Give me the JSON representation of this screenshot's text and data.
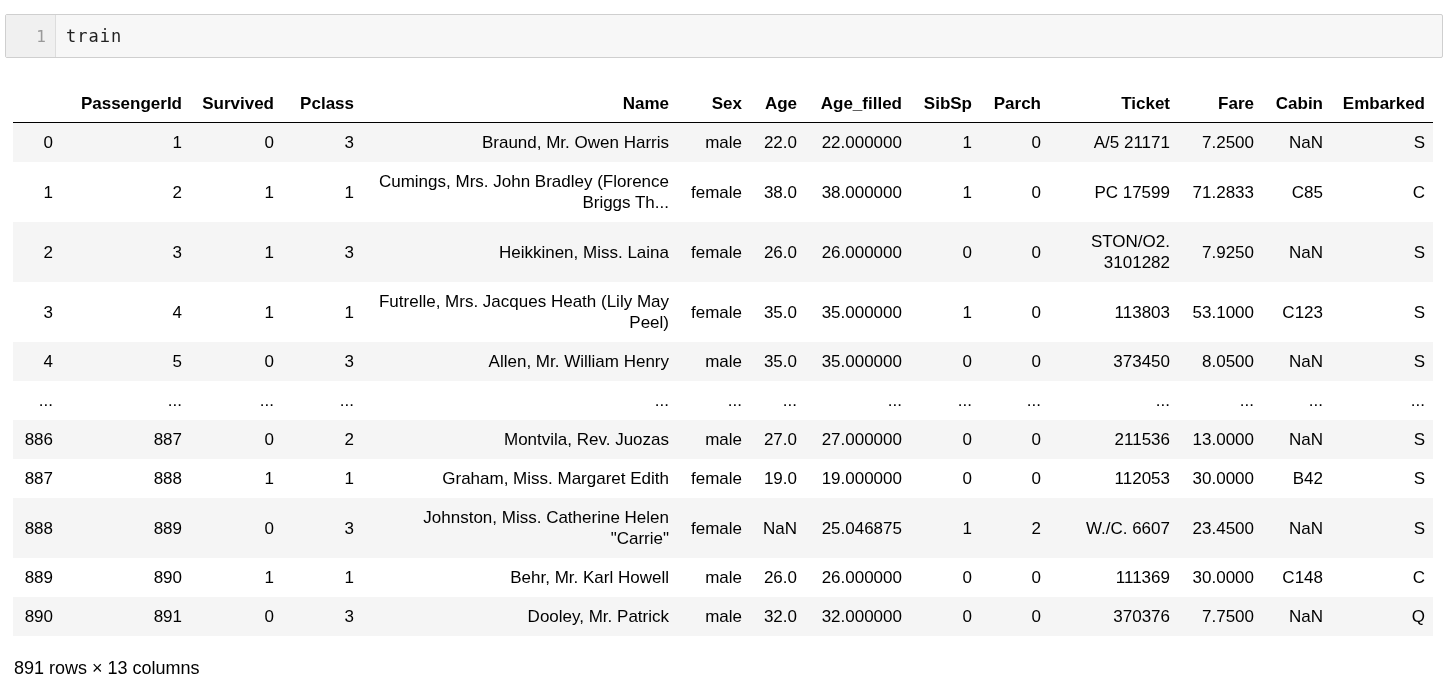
{
  "code_cell": {
    "line_number": "1",
    "code": "train"
  },
  "table": {
    "columns": [
      "PassengerId",
      "Survived",
      "Pclass",
      "Name",
      "Sex",
      "Age",
      "Age_filled",
      "SibSp",
      "Parch",
      "Ticket",
      "Fare",
      "Cabin",
      "Embarked"
    ],
    "rows": [
      {
        "index": "0",
        "cells": [
          "1",
          "0",
          "3",
          "Braund, Mr. Owen Harris",
          "male",
          "22.0",
          "22.000000",
          "1",
          "0",
          "A/5 21171",
          "7.2500",
          "NaN",
          "S"
        ]
      },
      {
        "index": "1",
        "cells": [
          "2",
          "1",
          "1",
          "Cumings, Mrs. John Bradley (Florence Briggs Th...",
          "female",
          "38.0",
          "38.000000",
          "1",
          "0",
          "PC 17599",
          "71.2833",
          "C85",
          "C"
        ]
      },
      {
        "index": "2",
        "cells": [
          "3",
          "1",
          "3",
          "Heikkinen, Miss. Laina",
          "female",
          "26.0",
          "26.000000",
          "0",
          "0",
          "STON/O2. 3101282",
          "7.9250",
          "NaN",
          "S"
        ]
      },
      {
        "index": "3",
        "cells": [
          "4",
          "1",
          "1",
          "Futrelle, Mrs. Jacques Heath (Lily May Peel)",
          "female",
          "35.0",
          "35.000000",
          "1",
          "0",
          "113803",
          "53.1000",
          "C123",
          "S"
        ]
      },
      {
        "index": "4",
        "cells": [
          "5",
          "0",
          "3",
          "Allen, Mr. William Henry",
          "male",
          "35.0",
          "35.000000",
          "0",
          "0",
          "373450",
          "8.0500",
          "NaN",
          "S"
        ]
      },
      {
        "index": "...",
        "cells": [
          "...",
          "...",
          "...",
          "...",
          "...",
          "...",
          "...",
          "...",
          "...",
          "...",
          "...",
          "...",
          "..."
        ]
      },
      {
        "index": "886",
        "cells": [
          "887",
          "0",
          "2",
          "Montvila, Rev. Juozas",
          "male",
          "27.0",
          "27.000000",
          "0",
          "0",
          "211536",
          "13.0000",
          "NaN",
          "S"
        ]
      },
      {
        "index": "887",
        "cells": [
          "888",
          "1",
          "1",
          "Graham, Miss. Margaret Edith",
          "female",
          "19.0",
          "19.000000",
          "0",
          "0",
          "112053",
          "30.0000",
          "B42",
          "S"
        ]
      },
      {
        "index": "888",
        "cells": [
          "889",
          "0",
          "3",
          "Johnston, Miss. Catherine Helen \"Carrie\"",
          "female",
          "NaN",
          "25.046875",
          "1",
          "2",
          "W./C. 6607",
          "23.4500",
          "NaN",
          "S"
        ]
      },
      {
        "index": "889",
        "cells": [
          "890",
          "1",
          "1",
          "Behr, Mr. Karl Howell",
          "male",
          "26.0",
          "26.000000",
          "0",
          "0",
          "111369",
          "30.0000",
          "C148",
          "C"
        ]
      },
      {
        "index": "890",
        "cells": [
          "891",
          "0",
          "3",
          "Dooley, Mr. Patrick",
          "male",
          "32.0",
          "32.000000",
          "0",
          "0",
          "370376",
          "7.7500",
          "NaN",
          "Q"
        ]
      }
    ]
  },
  "summary": "891 rows × 13 columns"
}
